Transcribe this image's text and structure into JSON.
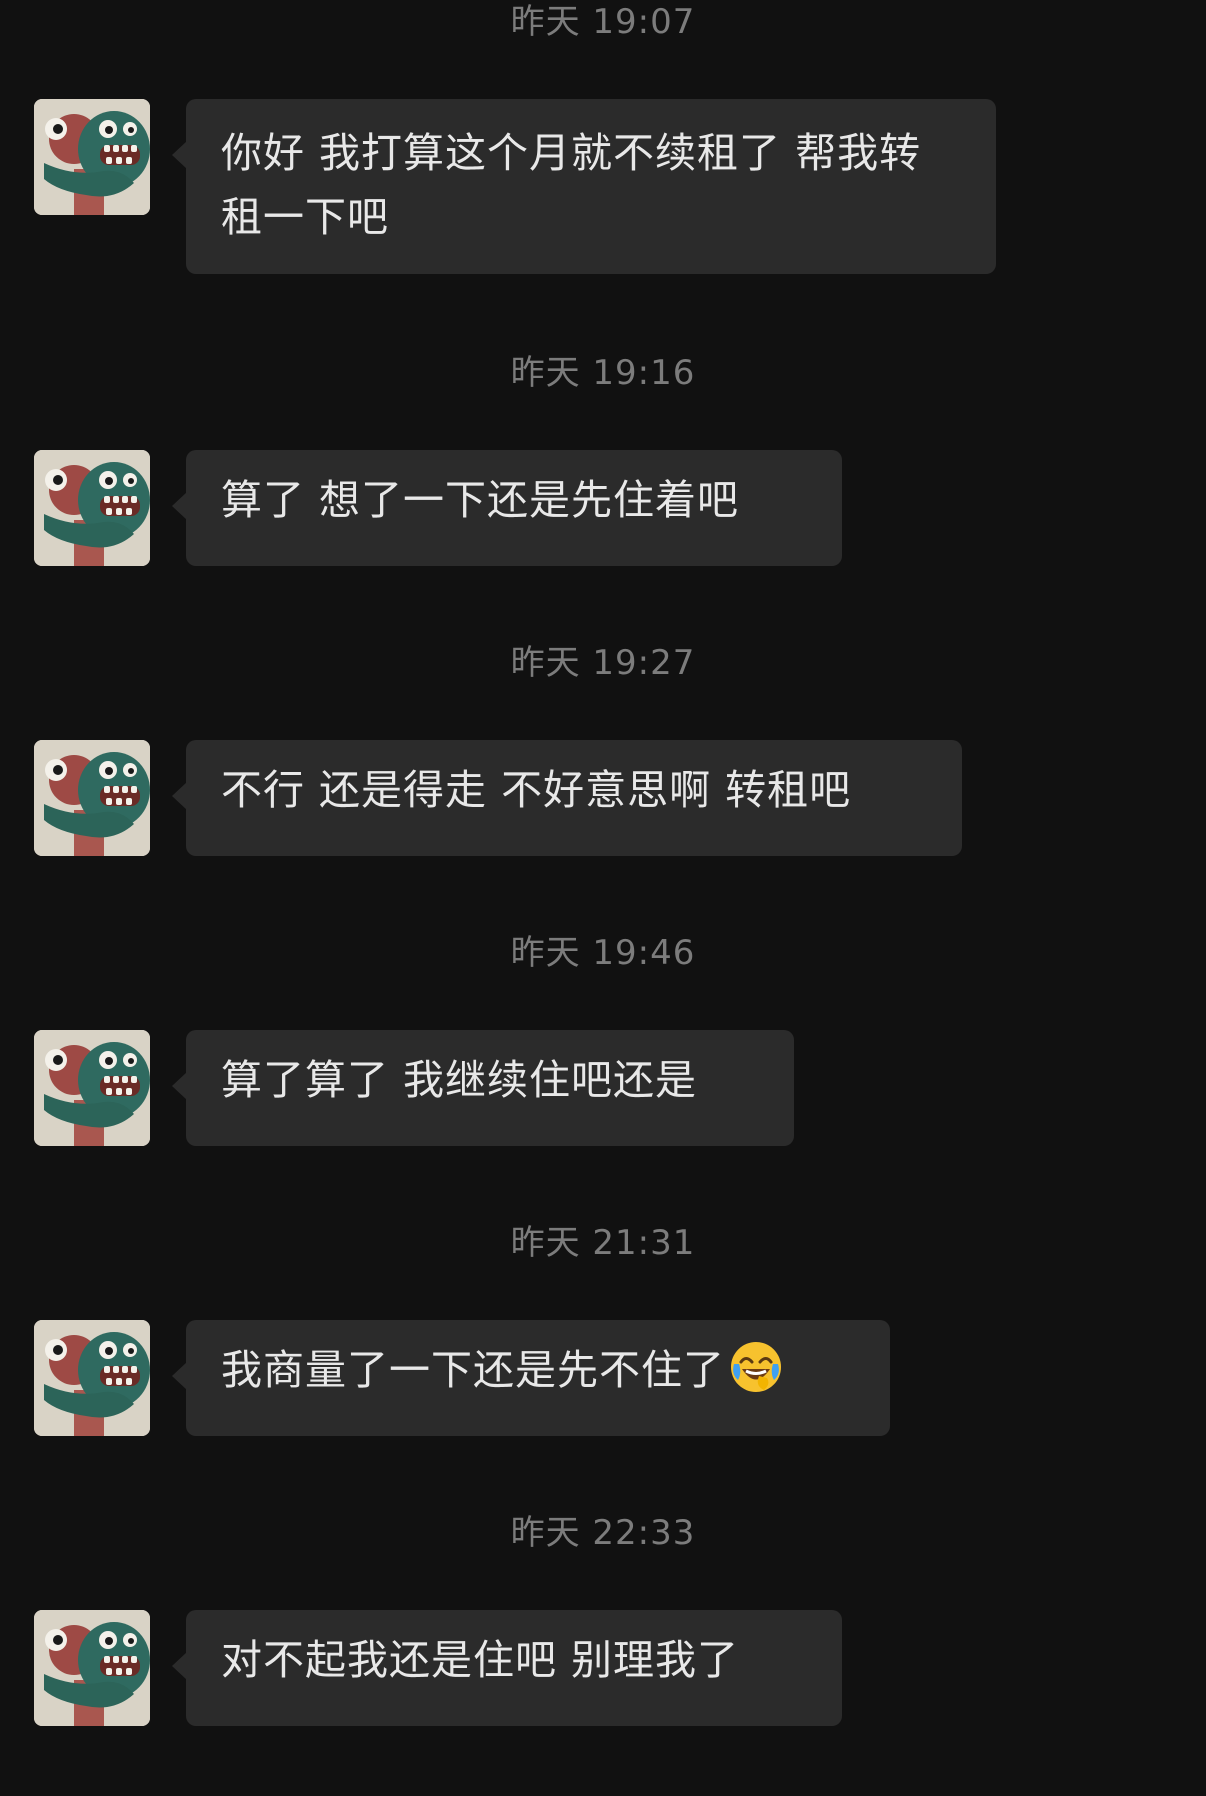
{
  "chat": {
    "colors": {
      "background": "#111111",
      "bubble": "#2b2b2b",
      "text": "#e8e8e8",
      "timestamp": "#7c7c7c"
    },
    "messages": [
      {
        "timestamp": "昨天 19:07",
        "text": "你好 我打算这个月就不续租了 帮我转租一下吧"
      },
      {
        "timestamp": "昨天 19:16",
        "text": "算了 想了一下还是先住着吧"
      },
      {
        "timestamp": "昨天 19:27",
        "text": "不行 还是得走 不好意思啊 转租吧"
      },
      {
        "timestamp": "昨天 19:46",
        "text": "算了算了 我继续住吧还是"
      },
      {
        "timestamp": "昨天 21:31",
        "text": "我商量了一下还是先不住了",
        "emoji": "face-with-tears-of-joy-icon"
      },
      {
        "timestamp": "昨天 22:33",
        "text": "对不起我还是住吧 别理我了"
      }
    ]
  }
}
